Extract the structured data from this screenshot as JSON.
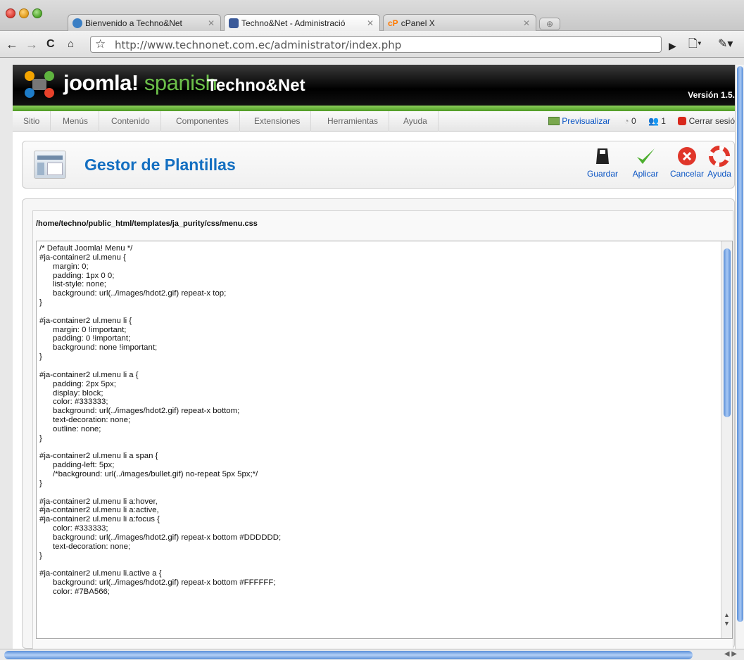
{
  "browser": {
    "tabs": [
      {
        "title": "Bienvenido a Techno&Net",
        "active": false,
        "favicon_color": "#3b7fc4"
      },
      {
        "title": "Techno&Net - Administració",
        "active": true,
        "favicon_color": "#3b5a99"
      },
      {
        "title": "cPanel X",
        "active": false,
        "favicon_color": "#ff7a00"
      }
    ],
    "url": "http://www.technonet.com.ec/administrator/index.php",
    "icons": {
      "back": "back-arrow-icon",
      "forward": "forward-arrow-icon",
      "reload": "reload-icon",
      "home": "home-icon",
      "bookmark": "star-icon",
      "page_menu": "page-menu-icon",
      "tools_menu": "wrench-icon"
    }
  },
  "joomla": {
    "brand_main": "joomla!",
    "brand_lang": "spanish",
    "site_name": "Techno&Net",
    "version": "Versión 1.5.",
    "menu": [
      "Sitio",
      "Menús",
      "Contenido",
      "Componentes",
      "Extensiones",
      "Herramientas",
      "Ayuda"
    ],
    "status": {
      "preview": "Previsualizar",
      "messages_count": "0",
      "users_count": "1",
      "logout": "Cerrar sesió"
    },
    "page_title": "Gestor de Plantillas",
    "toolbar": {
      "save": "Guardar",
      "apply": "Aplicar",
      "cancel": "Cancelar",
      "help": "Ayuda"
    },
    "file_path": "/home/techno/public_html/templates/ja_purity/css/menu.css",
    "css_content": "/* Default Joomla! Menu */\n#ja-container2 ul.menu {\n      margin: 0;\n      padding: 1px 0 0;\n      list-style: none;\n      background: url(../images/hdot2.gif) repeat-x top;\n}\n\n#ja-container2 ul.menu li {\n      margin: 0 !important;\n      padding: 0 !important;\n      background: none !important;\n}\n\n#ja-container2 ul.menu li a {\n      padding: 2px 5px;\n      display: block;\n      color: #333333;\n      background: url(../images/hdot2.gif) repeat-x bottom;\n      text-decoration: none;\n      outline: none;\n}\n\n#ja-container2 ul.menu li a span {\n      padding-left: 5px;\n      /*background: url(../images/bullet.gif) no-repeat 5px 5px;*/\n}\n\n#ja-container2 ul.menu li a:hover,\n#ja-container2 ul.menu li a:active,\n#ja-container2 ul.menu li a:focus {\n      color: #333333;\n      background: url(../images/hdot2.gif) repeat-x bottom #DDDDDD;\n      text-decoration: none;\n}\n\n#ja-container2 ul.menu li.active a {\n      background: url(../images/hdot2.gif) repeat-x bottom #FFFFFF;\n      color: #7BA566;"
  },
  "colors": {
    "accent_blue": "#146fc1",
    "joomla_green": "#6cc04a",
    "header_black": "#000000"
  }
}
